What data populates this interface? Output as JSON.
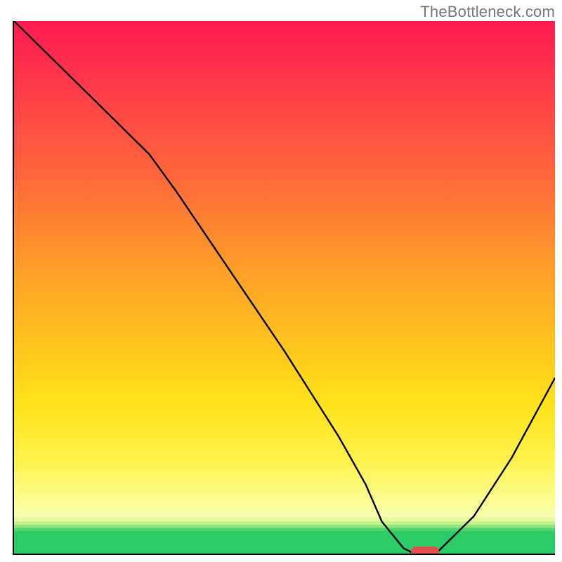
{
  "watermark": "TheBottleneck.com",
  "colors": {
    "curve": "#000000",
    "marker": "#e2504e",
    "axis": "#000000"
  },
  "chart_data": {
    "type": "line",
    "title": "",
    "xlabel": "",
    "ylabel": "",
    "xlim": [
      0,
      100
    ],
    "ylim": [
      0,
      100
    ],
    "grid": false,
    "series": [
      {
        "name": "bottleneck-curve",
        "x": [
          0,
          10,
          20,
          25,
          30,
          40,
          50,
          60,
          65,
          68,
          72,
          74,
          78,
          85,
          92,
          100
        ],
        "y": [
          100,
          90,
          80,
          75,
          68,
          53,
          38,
          22,
          13,
          6,
          1,
          0,
          0,
          7,
          18,
          33
        ]
      }
    ],
    "annotations": [
      {
        "name": "optimal-marker",
        "x": 76,
        "y": 0,
        "type": "pill"
      }
    ],
    "background": "rainbow-vertical"
  }
}
